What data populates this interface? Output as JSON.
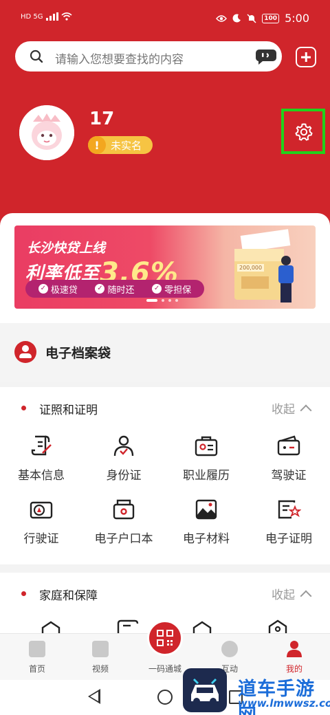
{
  "status_bar": {
    "network": "HD 5G",
    "battery": "100",
    "time": "5:00"
  },
  "search": {
    "placeholder": "请输入您想要查找的内容"
  },
  "profile": {
    "name": "17",
    "verify_badge": "未实名"
  },
  "banner": {
    "line1": "长沙快贷上线",
    "line2_prefix": "利率低至",
    "rate": "3.6%",
    "features": [
      "极速贷",
      "随时还",
      "零担保"
    ],
    "box_number": "200,000",
    "slide_index": 1,
    "slide_count": 4
  },
  "archive": {
    "title": "电子档案袋"
  },
  "section1": {
    "title": "证照和证明",
    "collapse": "收起",
    "items": [
      {
        "label": "基本信息",
        "icon": "document-pen-icon"
      },
      {
        "label": "身份证",
        "icon": "id-person-icon"
      },
      {
        "label": "职业履历",
        "icon": "career-badge-icon"
      },
      {
        "label": "驾驶证",
        "icon": "driver-license-icon"
      },
      {
        "label": "行驶证",
        "icon": "vehicle-license-icon"
      },
      {
        "label": "电子户口本",
        "icon": "household-book-icon"
      },
      {
        "label": "电子材料",
        "icon": "image-material-icon"
      },
      {
        "label": "电子证明",
        "icon": "certificate-icon"
      }
    ]
  },
  "section2": {
    "title": "家庭和保障",
    "collapse": "收起"
  },
  "tabbar": {
    "items": [
      {
        "label": "首页",
        "icon": "home-icon"
      },
      {
        "label": "视频",
        "icon": "video-icon"
      },
      {
        "label": "一码通城",
        "icon": "qr-code-icon"
      },
      {
        "label": "互动",
        "icon": "chat-icon"
      },
      {
        "label": "我的",
        "icon": "user-icon"
      }
    ],
    "active": "我的"
  },
  "watermark": {
    "name": "道车手游网",
    "url": "www.lmwwsz.com"
  },
  "colors": {
    "brand_red": "#d0252b",
    "badge_yellow": "#f6c443",
    "highlight_green": "#21d21b",
    "watermark_blue": "#1b6dd9"
  }
}
